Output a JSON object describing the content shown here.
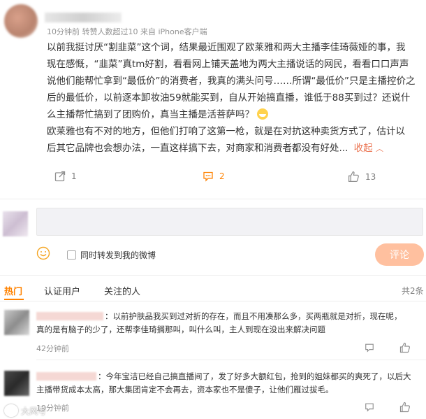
{
  "post": {
    "meta_time": "10分钟前",
    "meta_reposts": "转赞人数超过10",
    "meta_source": "来自 iPhone客户端",
    "body_line1": "以前我挺讨厌“割韭菜”这个词，结果最近围观了欧莱雅和两大主播李佳琦薇娅的事，我",
    "body_line2": "现在感慨，“韭菜”真tm好割，看看网上铺天盖地为两大主播说话的网民，看看口口声声",
    "body_line3": "说他们能帮忙拿到“最低价”的消费者，我真的满头问号……所谓“最低价”只是主播控价之",
    "body_line4": "后的最低价，以前逐本卸妆油59就能买到，自从开始搞直播，谁低于88买到过？还说什",
    "body_line5": "么主播帮忙搞到了团购价，真当主播是活菩萨吗？",
    "body_line6": "欧莱雅也有不对的地方，但他们打响了这第一枪，就是在对抗这种卖货方式了，估计以",
    "body_line7": "后其它品牌也会想办法，一直这样搞下去，对商家和消费者都没有好处...",
    "collapse_label": "收起",
    "repost_count": "1",
    "comment_count": "2",
    "like_count": "13"
  },
  "composer": {
    "sync_label": "同时转发到我的微博",
    "submit_label": "评论"
  },
  "tabs": [
    {
      "label": "热门"
    },
    {
      "label": "认证用户"
    },
    {
      "label": "关注的人"
    }
  ],
  "total_label": "共2条",
  "comments": [
    {
      "text1": "：以前护肤品我买到过对折的存在，而且不用凑那么多，买两瓶就是对折，现在呢，",
      "text2": "真的是有脑子的少了，还帮李佳琦搁那叫，叫什么叫，主人到现在没出来解决问题",
      "time": "42分钟前"
    },
    {
      "text1": "：今年宝洁已经自己搞直播间了，发了好多大额红包，抢到的姐妹都买的爽死了，以后大",
      "text2": "主播带货成本太高，那大集团肯定不会再去，资本家也不是傻子，让他们雁过拔毛。",
      "time": "19分钟前"
    }
  ],
  "watermark": "大风号",
  "colors": {
    "accent": "#ff8200",
    "blue_link": "#eb7350",
    "submit_bg": "#ffc09f"
  }
}
